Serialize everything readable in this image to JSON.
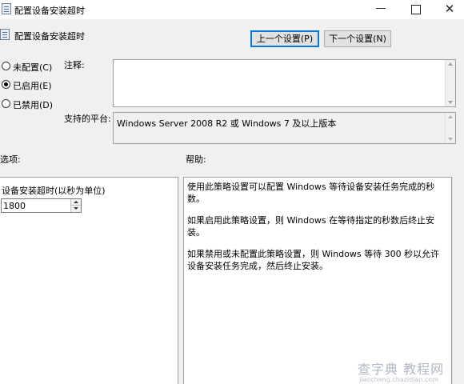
{
  "window": {
    "title": "配置设备安装超时",
    "minimize": "—",
    "close": "✕",
    "app_icon": "policy-icon"
  },
  "header": {
    "title": "配置设备安装超时",
    "prev_button": "上一个设置(P)",
    "next_button": "下一个设置(N)"
  },
  "state": {
    "options": [
      {
        "label": "未配置(C)",
        "checked": false
      },
      {
        "label": "已启用(E)",
        "checked": true
      },
      {
        "label": "已禁用(D)",
        "checked": false
      }
    ]
  },
  "comment": {
    "label": "注释:",
    "value": ""
  },
  "platform": {
    "label": "支持的平台:",
    "value": "Windows Server 2008 R2 或 Windows 7 及以上版本"
  },
  "options_section": {
    "heading": "选项:",
    "timeout_label": "设备安装超时(以秒为单位)",
    "timeout_value": "1800"
  },
  "help_section": {
    "heading": "帮助:",
    "paragraphs": [
      "使用此策略设置可以配置 Windows 等待设备安装任务完成的秒数。",
      "如果启用此策略设置，则 Windows 在等待指定的秒数后终止安装。",
      "如果禁用或未配置此策略设置，则 Windows 等待 300 秒以允许设备安装任务完成，然后终止安装。"
    ]
  },
  "watermark": {
    "main": "查字典 教程网",
    "url": "jiaocheng.chazidian.com"
  }
}
